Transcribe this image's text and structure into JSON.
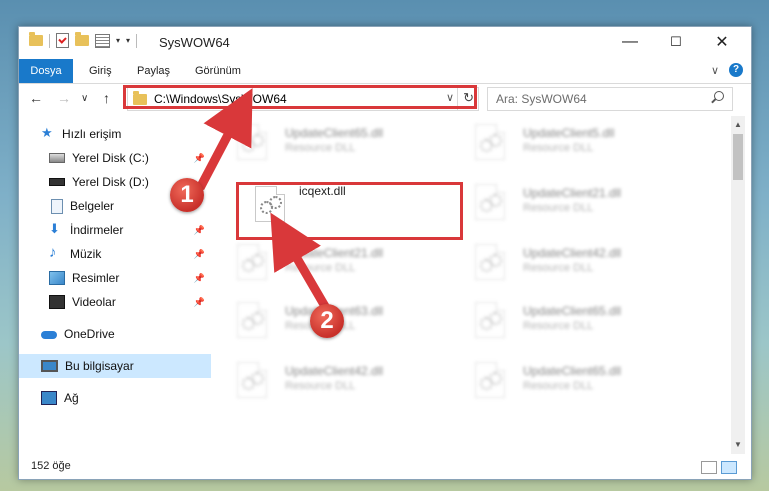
{
  "window": {
    "title": "SysWOW64",
    "minimize": "—",
    "maximize": "☐",
    "close": "✕"
  },
  "ribbon": {
    "tabs": [
      "Dosya",
      "Giriş",
      "Paylaş",
      "Görünüm"
    ],
    "expand": "∨",
    "help": "?"
  },
  "nav": {
    "back": "←",
    "forward": "→",
    "recent": "∨",
    "up": "↑",
    "address": "C:\\Windows\\SysWOW64",
    "address_caret": "∨",
    "refresh": "↻",
    "search_placeholder": "Ara: SysWOW64"
  },
  "sidebar": {
    "items": [
      {
        "label": "Hızlı erişim",
        "icon": "star-icon"
      },
      {
        "label": "Yerel Disk (C:)",
        "icon": "disk-icon"
      },
      {
        "label": "Yerel Disk (D:)",
        "icon": "disk-icon"
      },
      {
        "label": "Belgeler",
        "icon": "document-icon"
      },
      {
        "label": "İndirmeler",
        "icon": "download-icon"
      },
      {
        "label": "Müzik",
        "icon": "music-icon"
      },
      {
        "label": "Resimler",
        "icon": "pictures-icon"
      },
      {
        "label": "Videolar",
        "icon": "videos-icon"
      },
      {
        "label": "OneDrive",
        "icon": "cloud-icon"
      },
      {
        "label": "Bu bilgisayar",
        "icon": "computer-icon"
      },
      {
        "label": "Ağ",
        "icon": "network-icon"
      }
    ]
  },
  "files": {
    "col1": [
      {
        "name": "UpdateClient65.dll",
        "type": "Resource DLL"
      },
      {
        "name": "icqext.dll",
        "type": ""
      },
      {
        "name": "UpdateClient21.dll",
        "type": "Resource DLL"
      },
      {
        "name": "UpdateClient63.dll",
        "type": "Resource DLL"
      },
      {
        "name": "UpdateClient42.dll",
        "type": "Resource DLL"
      }
    ],
    "col2": [
      {
        "name": "UpdateClient5.dll",
        "type": "Resource DLL"
      },
      {
        "name": "UpdateClient21.dll",
        "type": "Resource DLL"
      },
      {
        "name": "UpdateClient42.dll",
        "type": "Resource DLL"
      },
      {
        "name": "UpdateClient65.dll",
        "type": "Resource DLL"
      },
      {
        "name": "UpdateClient65.dll",
        "type": "Resource DLL"
      }
    ]
  },
  "status": {
    "count": "152 öğe"
  },
  "markers": [
    "1",
    "2"
  ],
  "colors": {
    "accent": "#1979ca",
    "highlight": "#d9383a",
    "selected": "#cce8ff"
  }
}
